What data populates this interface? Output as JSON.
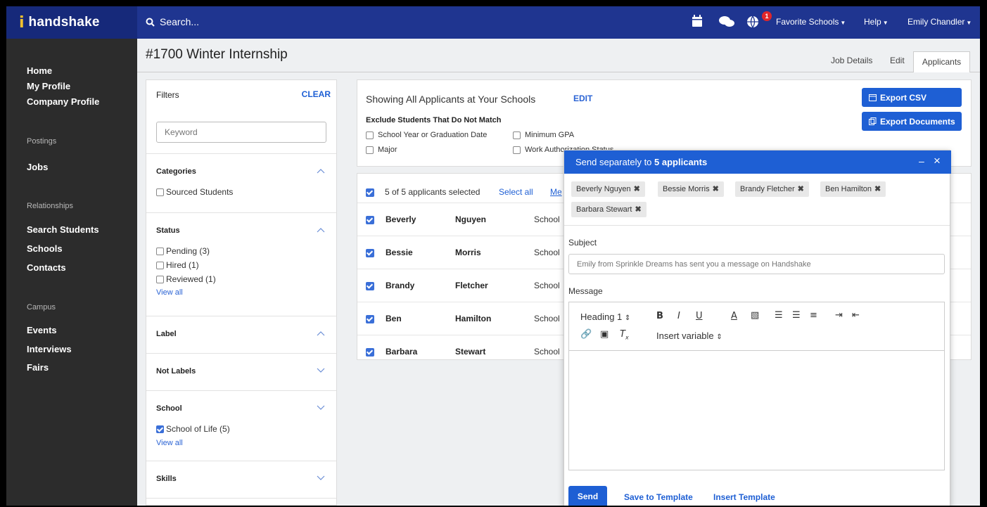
{
  "brand": {
    "name": "handshake",
    "mark": "i",
    "accent": "#f2c12e",
    "topbar_color": "#1f3590"
  },
  "topbar": {
    "search_placeholder": "Search...",
    "notification_count": "1",
    "favorite_schools": "Favorite Schools",
    "help": "Help",
    "user": "Emily Chandler"
  },
  "sidebar": {
    "items_top": [
      "Home",
      "My Profile",
      "Company Profile"
    ],
    "postings_header": "Postings",
    "postings_items": [
      "Jobs"
    ],
    "relationships_header": "Relationships",
    "relationships_items": [
      "Search Students",
      "Schools",
      "Contacts"
    ],
    "campus_header": "Campus",
    "campus_items": [
      "Events",
      "Interviews",
      "Fairs"
    ]
  },
  "page": {
    "title": "#1700 Winter Internship",
    "tabs": [
      "Job Details",
      "Edit",
      "Applicants"
    ],
    "active_tab": "Applicants"
  },
  "filters": {
    "title": "Filters",
    "clear": "CLEAR",
    "keyword_placeholder": "Keyword",
    "categories": {
      "title": "Categories",
      "options": [
        "Sourced Students"
      ]
    },
    "status": {
      "title": "Status",
      "options": [
        "Pending (3)",
        "Hired (1)",
        "Reviewed (1)"
      ],
      "view_all": "View all"
    },
    "label": {
      "title": "Label"
    },
    "not_labels": {
      "title": "Not Labels"
    },
    "school": {
      "title": "School",
      "options": [
        "School of Life (5)"
      ],
      "view_all": "View all"
    },
    "skills": {
      "title": "Skills"
    }
  },
  "applicants_header": {
    "showing": "Showing All Applicants at Your Schools",
    "edit": "EDIT",
    "exclude_title": "Exclude Students That Do Not Match",
    "exclude_options": [
      "School Year or Graduation Date",
      "Minimum GPA",
      "Major",
      "Work Authorization Status"
    ],
    "export_csv": "Export CSV",
    "export_documents": "Export Documents"
  },
  "applicants": {
    "selected_text": "5 of 5 applicants selected",
    "select_all": "Select all",
    "message_link": "Me",
    "rows": [
      {
        "first": "Beverly",
        "last": "Nguyen",
        "school": "School"
      },
      {
        "first": "Bessie",
        "last": "Morris",
        "school": "School"
      },
      {
        "first": "Brandy",
        "last": "Fletcher",
        "school": "School"
      },
      {
        "first": "Ben",
        "last": "Hamilton",
        "school": "School"
      },
      {
        "first": "Barbara",
        "last": "Stewart",
        "school": "School"
      }
    ]
  },
  "modal": {
    "title_prefix": "Send separately to ",
    "title_count": "5 applicants",
    "minimize": "–",
    "close": "×",
    "recipients": [
      "Beverly Nguyen",
      "Bessie Morris",
      "Brandy Fletcher",
      "Ben Hamilton",
      "Barbara Stewart"
    ],
    "subject_label": "Subject",
    "subject_placeholder": "Emily from Sprinkle Dreams has sent you a message on Handshake",
    "message_label": "Message",
    "heading_select": "Heading 1",
    "insert_variable": "Insert variable",
    "send": "Send",
    "save_template": "Save to Template",
    "insert_template": "Insert Template"
  }
}
